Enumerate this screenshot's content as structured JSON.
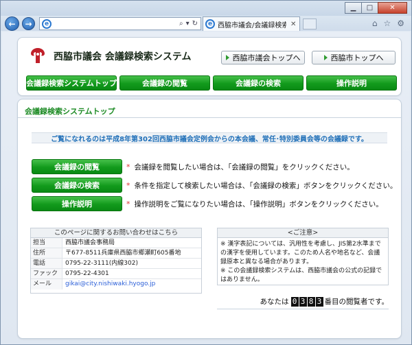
{
  "browser": {
    "tab_title": "西脇市議会/会議録検索シ...",
    "back_symbol": "←",
    "forward_symbol": "→"
  },
  "header": {
    "site_title": "西脇市議会 会議録検索システム",
    "links": [
      {
        "label": "西脇市議会トップへ"
      },
      {
        "label": "西脇市トップへ"
      }
    ],
    "nav": [
      {
        "label": "会議録検索システムトップ"
      },
      {
        "label": "会議録の閲覧"
      },
      {
        "label": "会議録の検索"
      },
      {
        "label": "操作説明"
      }
    ]
  },
  "main": {
    "section_title": "会議録検索システムトップ",
    "notice": "ご覧になれるのは平成8年第302回西脇市議会定例会からの本会議、常任･特別委員会等の会議録です。",
    "menu": [
      {
        "label": "会議録の閲覧",
        "desc": "会議録を閲覧したい場合は、「会議録の閲覧」をクリックください。"
      },
      {
        "label": "会議録の検索",
        "desc": "条件を指定して検索したい場合は、「会議録の検索」ボタンをクリックください。"
      },
      {
        "label": "操作説明",
        "desc": "操作説明をご覧になりたい場合は、「操作説明」ボタンをクリックください。"
      }
    ],
    "contact": {
      "heading": "このページに関するお問い合わせはこちら",
      "rows": [
        {
          "key": "担当",
          "value": "西脇市議会事務局"
        },
        {
          "key": "住所",
          "value": "〒677-8511兵庫県西脇市郷瀬町605番地"
        },
        {
          "key": "電話",
          "value": "0795-22-3111(内線302)"
        },
        {
          "key": "ファックス",
          "value": "0795-22-4301"
        },
        {
          "key": "メール",
          "value": "gikai@city.nishiwaki.hyogo.jp"
        }
      ]
    },
    "caution": {
      "heading": "<ご注意>",
      "text1": "※ 漢字表記については、汎用性を考慮し、JIS第2水準までの漢字を使用しています。このため人名や地名など、会議録原本と異なる場合があります。",
      "text2": "※ この会議録検索システムは、西脇市議会の公式の記録ではありません。"
    },
    "counter": {
      "prefix": "あなたは",
      "digits": [
        "0",
        "3",
        "8",
        "3"
      ],
      "suffix": "番目の閲覧者です。"
    }
  },
  "colors": {
    "accent_green": "#129a1c",
    "notice_blue": "#1f6fb8",
    "logo_red": "#c0202a"
  }
}
